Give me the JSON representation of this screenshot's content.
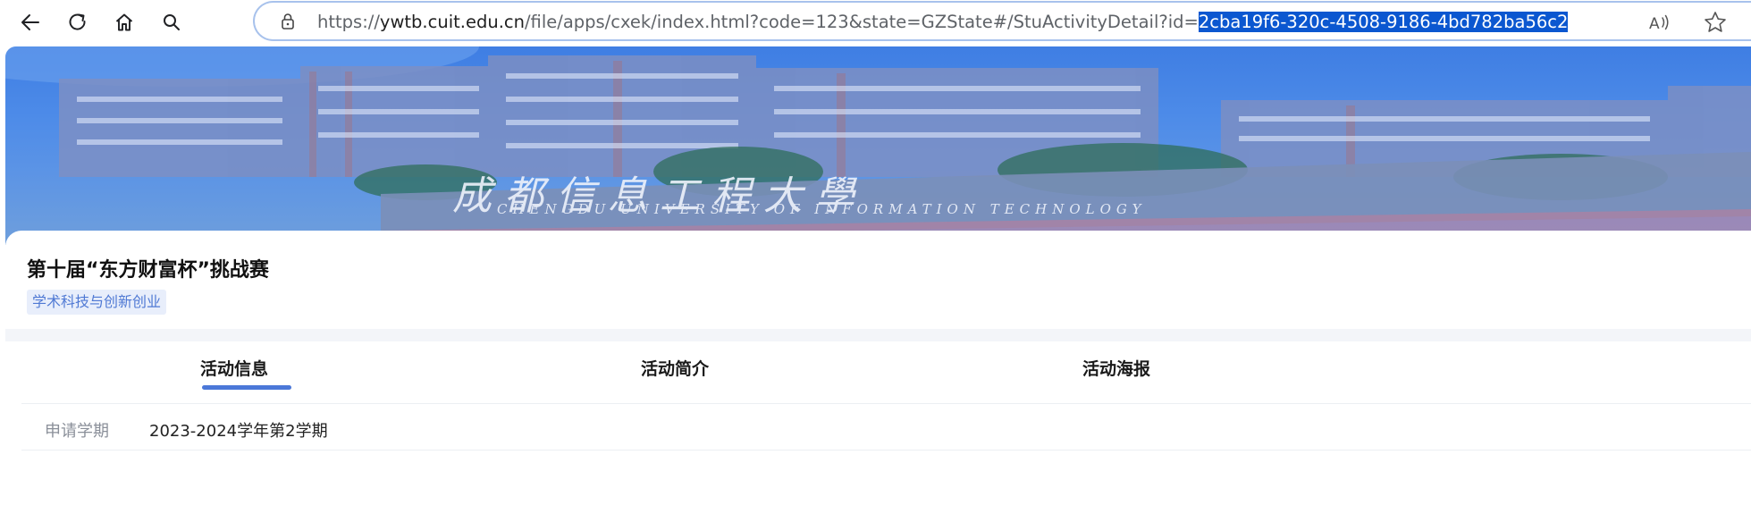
{
  "browser": {
    "url": {
      "prefix": "https://",
      "domain": "ywtb.cuit.edu.cn",
      "path": "/file/apps/cxek/index.html?code=123&state=GZState#/StuActivityDetail?id=",
      "selected": "2cba19f6-320c-4508-9186-4bd782ba56c2"
    },
    "icons": {
      "back": "back-arrow-icon",
      "refresh": "refresh-icon",
      "home": "home-icon",
      "search": "search-icon",
      "lock": "lock-icon",
      "read_aloud": "read-aloud-icon",
      "favorite": "star-icon"
    }
  },
  "banner": {
    "school_name": "成 都 信 息 工 程 大 學",
    "school_name_en": "CHENGDU UNIVERSITY OF INFORMATION TECHNOLOGY"
  },
  "activity": {
    "title": "第十届“东方财富杯”挑战赛",
    "tag": "学术科技与创新创业"
  },
  "tabs": [
    {
      "label": "活动信息",
      "active": true
    },
    {
      "label": "活动简介",
      "active": false
    },
    {
      "label": "活动海报",
      "active": false
    }
  ],
  "info": [
    {
      "label": "申请学期",
      "value": "2023-2024学年第2学期"
    }
  ],
  "colors": {
    "accent": "#4b78d8",
    "selection": "#0b57d0",
    "tag_bg": "#e8eefb",
    "tag_text": "#4f79d4"
  }
}
